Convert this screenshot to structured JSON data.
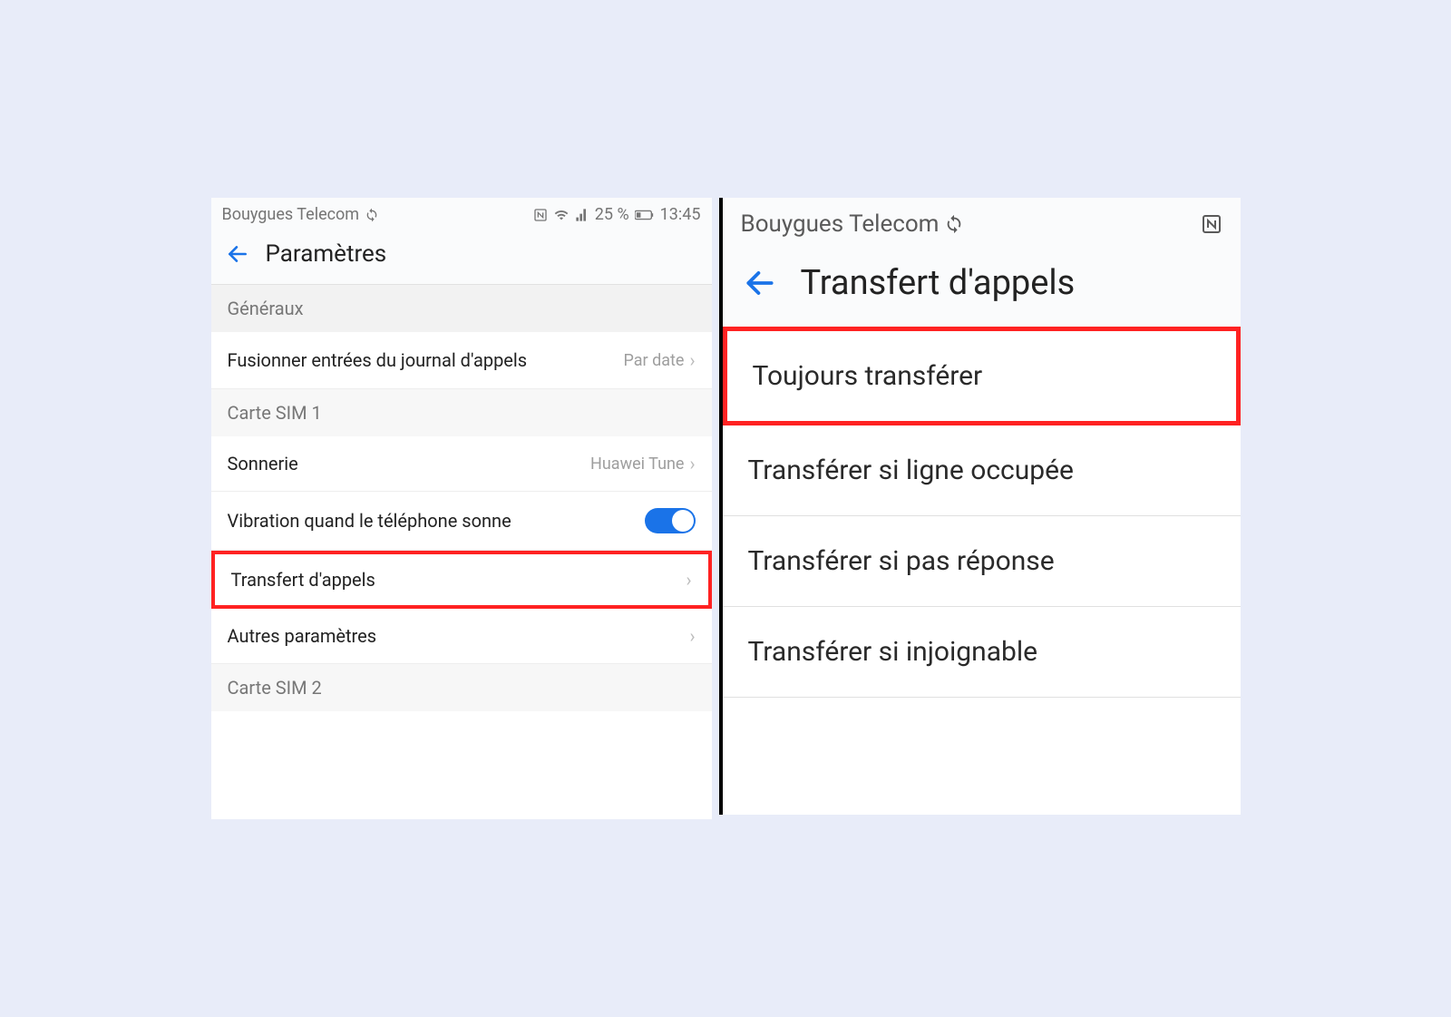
{
  "left": {
    "statusbar": {
      "carrier": "Bouygues Telecom",
      "battery_pct": "25 %",
      "time": "13:45"
    },
    "header": {
      "title": "Paramètres"
    },
    "sections": {
      "general_label": "Généraux",
      "merge_calllog": {
        "label": "Fusionner entrées du journal d'appels",
        "value": "Par date"
      },
      "sim1_label": "Carte SIM 1",
      "ringtone": {
        "label": "Sonnerie",
        "value": "Huawei Tune"
      },
      "vibrate": {
        "label": "Vibration quand le téléphone sonne",
        "on": true
      },
      "call_forward": {
        "label": "Transfert d'appels"
      },
      "other": {
        "label": "Autres paramètres"
      },
      "sim2_label": "Carte SIM 2"
    }
  },
  "right": {
    "statusbar": {
      "carrier": "Bouygues Telecom"
    },
    "header": {
      "title": "Transfert d'appels"
    },
    "items": [
      {
        "label": "Toujours transférer",
        "highlight": true
      },
      {
        "label": "Transférer si ligne occupée"
      },
      {
        "label": "Transférer si pas réponse"
      },
      {
        "label": "Transférer si injoignable"
      }
    ]
  }
}
